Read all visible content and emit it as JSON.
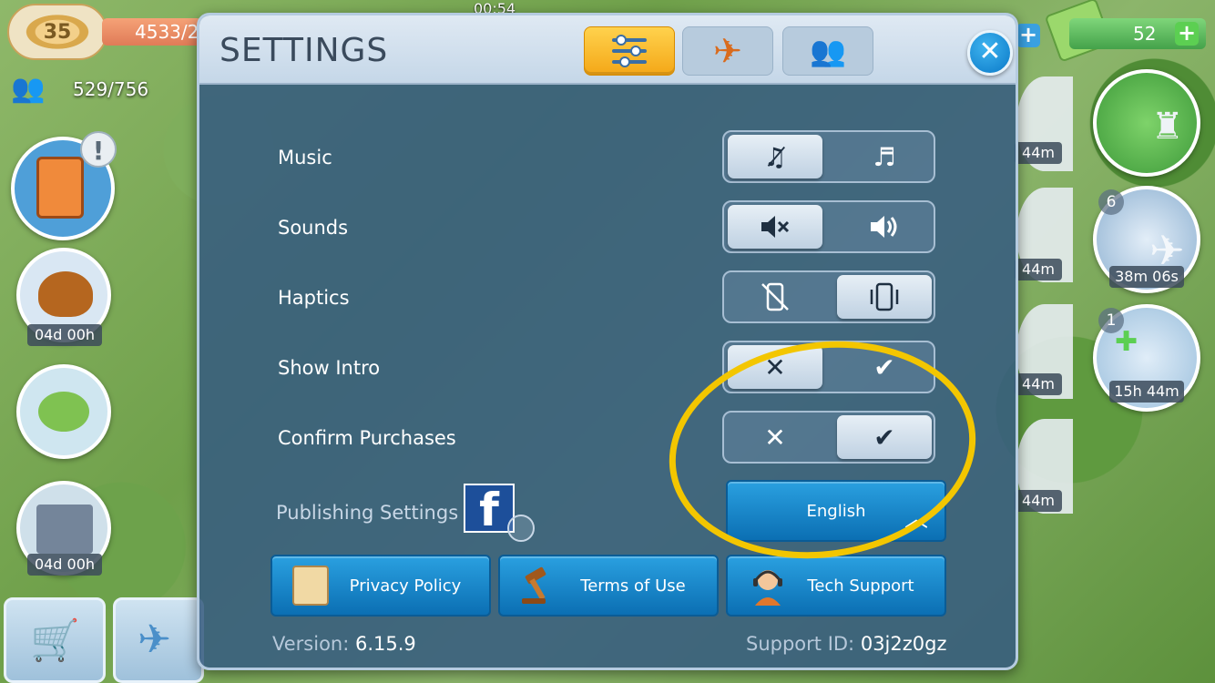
{
  "hud": {
    "level": "35",
    "coins": "4533/2",
    "clock": "00:54",
    "population": "529/756",
    "cash": "52",
    "timers": {
      "turkey": "04d 00h",
      "barn": "04d 00h",
      "radar2": "38m 06s",
      "gauge": "15h 44m",
      "side1": "44m",
      "side2": "44m",
      "side3": "44m",
      "side4": "44m"
    },
    "badges": {
      "radar2": "6",
      "gauge": "1"
    }
  },
  "dialog": {
    "title": "SETTINGS",
    "tabs": [
      {
        "icon": "sliders-icon",
        "active": true
      },
      {
        "icon": "airplane-icon",
        "active": false
      },
      {
        "icon": "people-icon",
        "active": false
      }
    ],
    "close_label": "✕",
    "settings": [
      {
        "label": "Music",
        "off_icon": "music-off-icon",
        "on_icon": "music-on-icon",
        "selected": "off"
      },
      {
        "label": "Sounds",
        "off_icon": "speaker-mute-icon",
        "on_icon": "speaker-on-icon",
        "selected": "off"
      },
      {
        "label": "Haptics",
        "off_icon": "vibrate-off-icon",
        "on_icon": "vibrate-on-icon",
        "selected": "on"
      },
      {
        "label": "Show Intro",
        "off_icon": "cross-icon",
        "on_icon": "check-icon",
        "selected": "off"
      },
      {
        "label": "Confirm Purchases",
        "off_icon": "cross-icon",
        "on_icon": "check-icon",
        "selected": "on"
      }
    ],
    "publishing_label": "Publishing Settings",
    "facebook_letter": "f",
    "language": "English",
    "buttons": {
      "privacy": "Privacy Policy",
      "terms": "Terms of Use",
      "support": "Tech Support"
    },
    "version_label": "Version:",
    "version_value": "6.15.9",
    "support_label": "Support ID:",
    "support_value": "03j2z0gz"
  },
  "colors": {
    "accent_active_tab": "#f4a717",
    "button_blue": "#0b6fb3",
    "annotation": "#f3c600"
  }
}
